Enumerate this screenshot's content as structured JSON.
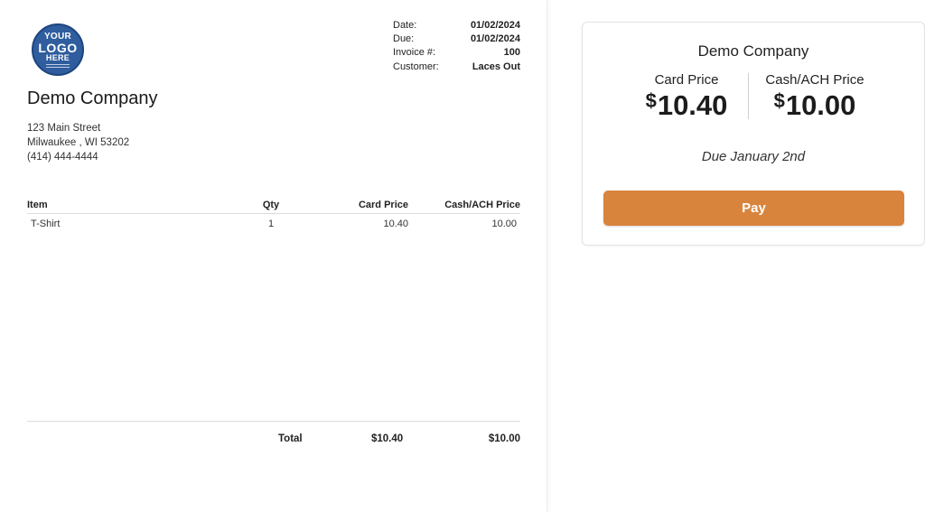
{
  "invoice": {
    "logo": {
      "line1": "YOUR",
      "line2": "LOGO",
      "line3": "HERE"
    },
    "meta": [
      {
        "label": "Date:",
        "value": "01/02/2024"
      },
      {
        "label": "Due:",
        "value": "01/02/2024"
      },
      {
        "label": "Invoice #:",
        "value": "100"
      },
      {
        "label": "Customer:",
        "value": "Laces Out"
      }
    ],
    "company": "Demo Company",
    "address": {
      "street": "123 Main Street",
      "city": "Milwaukee , WI 53202",
      "phone": "(414) 444-4444"
    },
    "columns": {
      "item": "Item",
      "qty": "Qty",
      "card": "Card Price",
      "cash": "Cash/ACH Price"
    },
    "lines": [
      {
        "item": "T-Shirt",
        "qty": "1",
        "card": "10.40",
        "cash": "10.00"
      }
    ],
    "totals": {
      "label": "Total",
      "card": "$10.40",
      "cash": "$10.00"
    }
  },
  "payment": {
    "company": "Demo Company",
    "card_label": "Card Price",
    "card_currency": "$",
    "card_amount": "10.40",
    "cash_label": "Cash/ACH Price",
    "cash_currency": "$",
    "cash_amount": "10.00",
    "due_text": "Due January 2nd",
    "pay_label": "Pay",
    "accent": "#d9843d"
  }
}
